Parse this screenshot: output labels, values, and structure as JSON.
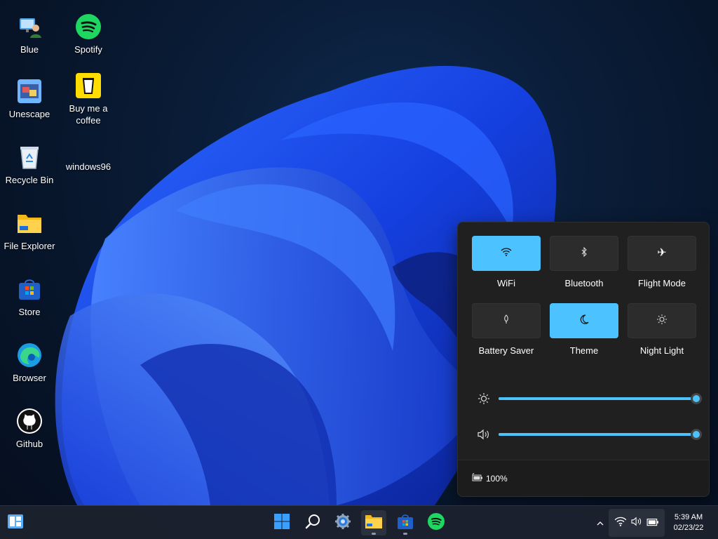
{
  "desktop": {
    "icons": [
      {
        "label": "Blue",
        "icon": "user-monitor-icon"
      },
      {
        "label": "Spotify",
        "icon": "spotify-icon"
      },
      {
        "label": "Unescape",
        "icon": "unescape-icon"
      },
      {
        "label": "Buy me a coffee",
        "icon": "coffee-cup-icon"
      },
      {
        "label": "Recycle Bin",
        "icon": "recycle-bin-icon"
      },
      {
        "label": "windows96",
        "icon": "windows96-icon"
      },
      {
        "label": "File Explorer",
        "icon": "folder-icon"
      },
      {
        "label": "Store",
        "icon": "store-icon"
      },
      {
        "label": "Browser",
        "icon": "edge-browser-icon"
      },
      {
        "label": "Github",
        "icon": "github-icon"
      }
    ]
  },
  "quick_settings": {
    "tiles": [
      {
        "label": "WiFi",
        "icon": "wifi-icon",
        "on": true
      },
      {
        "label": "Bluetooth",
        "icon": "bluetooth-icon",
        "on": false
      },
      {
        "label": "Flight Mode",
        "icon": "airplane-icon",
        "on": false
      },
      {
        "label": "Battery Saver",
        "icon": "battery-saver-icon",
        "on": false
      },
      {
        "label": "Theme",
        "icon": "moon-icon",
        "on": true
      },
      {
        "label": "Night Light",
        "icon": "night-light-icon",
        "on": false
      }
    ],
    "brightness": {
      "icon": "brightness-icon",
      "value_percent": 100
    },
    "volume": {
      "icon": "speaker-icon",
      "value_percent": 100
    },
    "battery": {
      "icon": "battery-icon",
      "text": "100%"
    }
  },
  "taskbar": {
    "widgets_icon": "widgets-icon",
    "apps": [
      {
        "name": "start",
        "icon": "windows-start-icon",
        "active": false
      },
      {
        "name": "search",
        "icon": "search-icon",
        "active": false
      },
      {
        "name": "settings",
        "icon": "settings-gear-icon",
        "active": false
      },
      {
        "name": "file-explorer",
        "icon": "folder-icon",
        "active": true
      },
      {
        "name": "store",
        "icon": "store-icon",
        "active": false
      },
      {
        "name": "spotify",
        "icon": "spotify-icon",
        "active": false
      }
    ],
    "tray": {
      "chevron_icon": "chevron-up-icon",
      "icons": [
        "wifi-icon",
        "speaker-icon",
        "battery-icon"
      ]
    },
    "clock": {
      "time": "5:39 AM",
      "date": "02/23/22"
    }
  },
  "colors": {
    "accent": "#4cc2ff",
    "panel": "#202020",
    "tile_off": "#2c2c2c"
  }
}
